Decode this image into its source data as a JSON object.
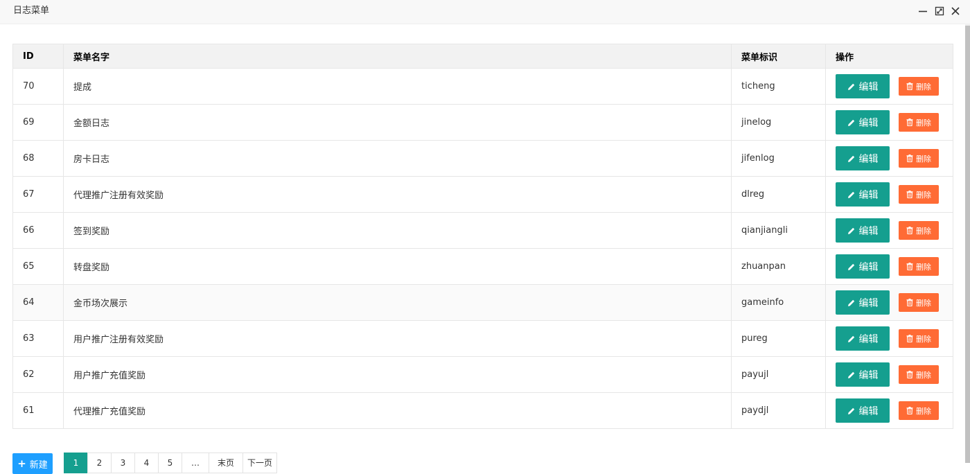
{
  "window": {
    "title": "日志菜单"
  },
  "table": {
    "headers": {
      "id": "ID",
      "name": "菜单名字",
      "tag": "菜单标识",
      "ops": "操作"
    },
    "rows": [
      {
        "id": "70",
        "name": "提成",
        "tag": "ticheng"
      },
      {
        "id": "69",
        "name": "金额日志",
        "tag": "jinelog"
      },
      {
        "id": "68",
        "name": "房卡日志",
        "tag": "jifenlog"
      },
      {
        "id": "67",
        "name": "代理推广注册有效奖励",
        "tag": "dlreg"
      },
      {
        "id": "66",
        "name": "签到奖励",
        "tag": "qianjiangli"
      },
      {
        "id": "65",
        "name": "转盘奖励",
        "tag": "zhuanpan"
      },
      {
        "id": "64",
        "name": "金币场次展示",
        "tag": "gameinfo"
      },
      {
        "id": "63",
        "name": "用户推广注册有效奖励",
        "tag": "pureg"
      },
      {
        "id": "62",
        "name": "用户推广充值奖励",
        "tag": "payujl"
      },
      {
        "id": "61",
        "name": "代理推广充值奖励",
        "tag": "paydjl"
      }
    ],
    "edit_label": "编辑",
    "delete_label": "删除"
  },
  "toolbar": {
    "new_label": "新建"
  },
  "pagination": {
    "pages": [
      "1",
      "2",
      "3",
      "4",
      "5"
    ],
    "current": "1",
    "ellipsis": "…",
    "last_label": "末页",
    "next_label": "下一页"
  },
  "colors": {
    "edit_button": "#159f8f",
    "delete_button": "#ff6b35",
    "new_button": "#1e9fff",
    "current_page": "#159f8f"
  },
  "icons": {
    "edit": "pencil-icon",
    "delete": "trash-icon",
    "new": "plus-icon",
    "window": [
      "minimize-icon",
      "maximize-icon",
      "close-icon"
    ]
  }
}
